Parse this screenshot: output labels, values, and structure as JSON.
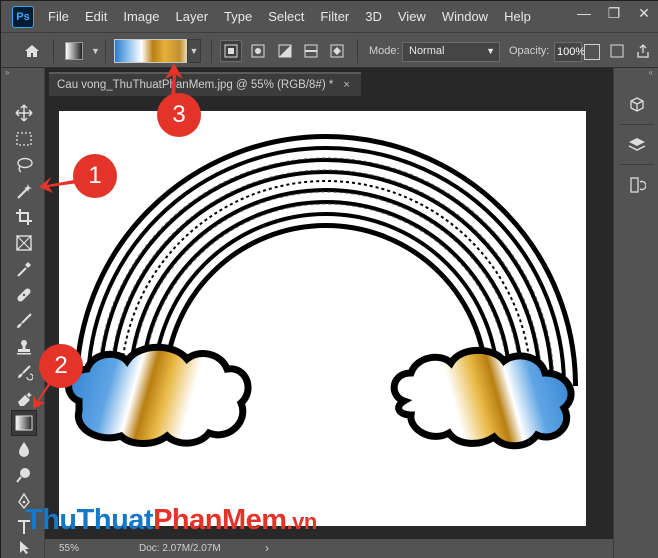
{
  "app": {
    "logo": "Ps"
  },
  "menubar": {
    "items": [
      "File",
      "Edit",
      "Image",
      "Layer",
      "Type",
      "Select",
      "Filter",
      "3D",
      "View",
      "Window",
      "Help"
    ]
  },
  "window_controls": {
    "minimize": "—",
    "restore": "❐",
    "close": "✕"
  },
  "options_bar": {
    "home_icon": "home-icon",
    "mode_label": "Mode:",
    "mode_value": "Normal",
    "opacity_label": "Opacity:",
    "opacity_value": "100%",
    "gradient_colors": [
      "#2a7cd0",
      "#ffffff",
      "#b87f12",
      "#e6b03a"
    ]
  },
  "document": {
    "tab_title": "Cau vong_ThuThuatPhanMem.jpg @ 55% (RGB/8#) *",
    "tab_close": "×",
    "zoom": "55%",
    "doc_size": "Doc: 2.07M/2.07M",
    "status_arrow": "›"
  },
  "tools": [
    "move-tool",
    "marquee-tool",
    "lasso-tool",
    "magic-wand-tool",
    "crop-tool",
    "frame-tool",
    "eyedropper-tool",
    "healing-brush-tool",
    "brush-tool",
    "clone-stamp-tool",
    "history-brush-tool",
    "eraser-tool",
    "gradient-tool",
    "blur-tool",
    "dodge-tool",
    "pen-tool"
  ],
  "callouts": [
    "1",
    "2",
    "3"
  ],
  "watermark": {
    "part1": "ThuThuat",
    "part2": "PhanMem",
    "part3": ".vn"
  },
  "colors": {
    "accent_red": "#e4342a",
    "brand_blue": "#1678c9",
    "gradient_gold": "#b87f12"
  }
}
